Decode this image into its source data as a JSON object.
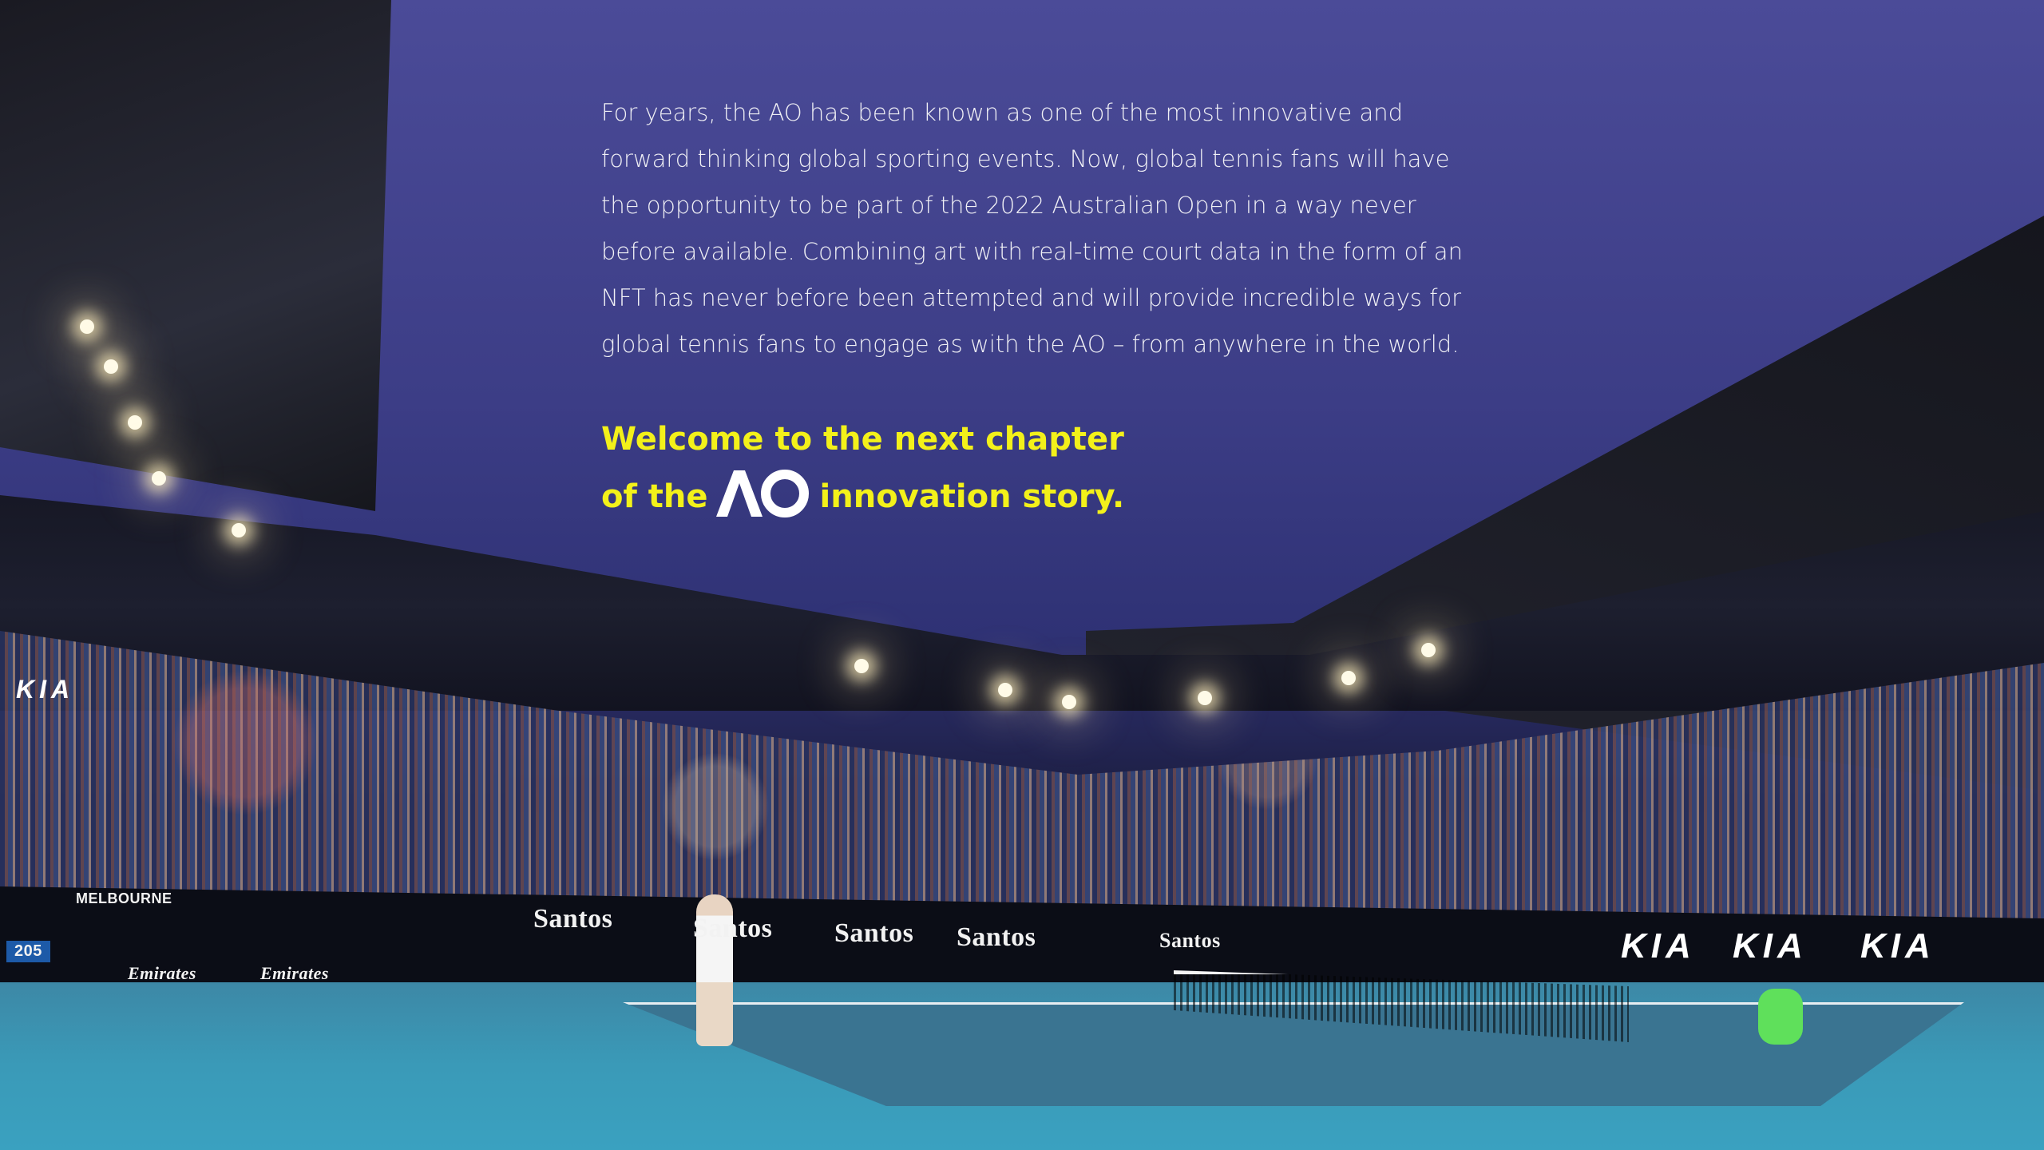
{
  "intro": {
    "paragraph": "For years, the AO has been known as one of the most innovative and forward thinking global sporting events. Now, global tennis fans will have the opportunity to be part of the 2022 Australian Open in a way never before available. Combining art with real-time court data in the form of an NFT has never before been attempted and will provide incredible ways for global tennis fans to engage as with the AO – from anywhere in the world."
  },
  "headline": {
    "line1": "Welcome to the next chapter",
    "prefix": "of the",
    "suffix": "innovation story.",
    "logo_label": "AO",
    "color": "#f3f11a"
  },
  "scene": {
    "sponsors": [
      "Santos",
      "Santos",
      "Santos",
      "Santos",
      "Santos"
    ],
    "kia": [
      "KIA",
      "KIA",
      "KIA",
      "KIA"
    ],
    "emirates": [
      "Emirates",
      "Emirates"
    ],
    "speed": "205",
    "melbourne": "MELBOURNE"
  }
}
